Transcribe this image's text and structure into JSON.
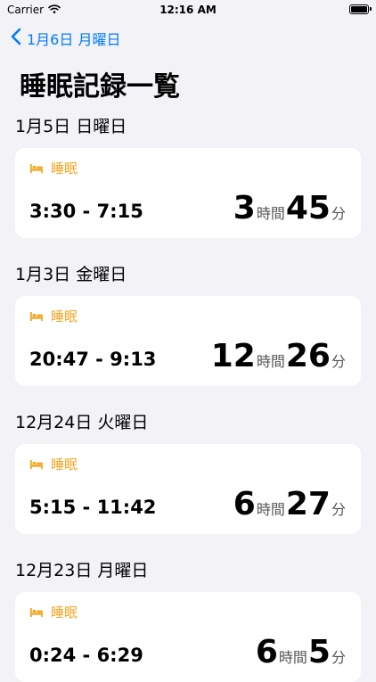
{
  "status_bar": {
    "carrier": "Carrier",
    "time": "12:16 AM"
  },
  "nav": {
    "back_label": "1月6日 月曜日"
  },
  "page": {
    "title": "睡眠記録一覧"
  },
  "colors": {
    "accent": "#007aff",
    "sleep_label": "#f5a623",
    "background": "#f2f2f7",
    "card": "#ffffff"
  },
  "sections": [
    {
      "header": "1月5日 日曜日",
      "card": {
        "label": "睡眠",
        "icon": "bed-icon",
        "range": "3:30 - 7:15",
        "hours": "3",
        "hours_unit": "時間",
        "minutes": "45",
        "minutes_unit": "分"
      }
    },
    {
      "header": "1月3日 金曜日",
      "card": {
        "label": "睡眠",
        "icon": "bed-icon",
        "range": "20:47 - 9:13",
        "hours": "12",
        "hours_unit": "時間",
        "minutes": "26",
        "minutes_unit": "分"
      }
    },
    {
      "header": "12月24日 火曜日",
      "card": {
        "label": "睡眠",
        "icon": "bed-icon",
        "range": "5:15 - 11:42",
        "hours": "6",
        "hours_unit": "時間",
        "minutes": "27",
        "minutes_unit": "分"
      }
    },
    {
      "header": "12月23日 月曜日",
      "card": {
        "label": "睡眠",
        "icon": "bed-icon",
        "range": "0:24 - 6:29",
        "hours": "6",
        "hours_unit": "時間",
        "minutes": "5",
        "minutes_unit": "分"
      }
    }
  ]
}
